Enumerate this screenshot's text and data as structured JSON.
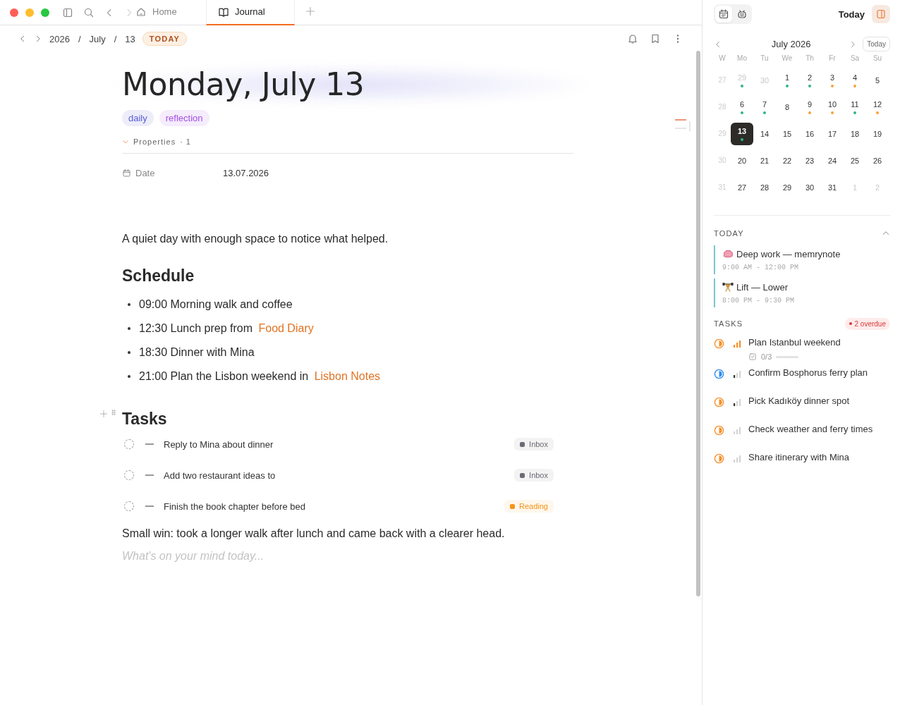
{
  "window": {
    "tabs": [
      {
        "label": "Home",
        "selected": false
      },
      {
        "label": "Journal",
        "selected": true
      }
    ]
  },
  "breadcrumb": {
    "parts": [
      "2026",
      "July",
      "13"
    ],
    "separator": "/",
    "badge": "TODAY"
  },
  "page": {
    "title": "Monday, July 13",
    "tags": [
      {
        "label": "daily",
        "color": "#5b5bd6"
      },
      {
        "label": "reflection",
        "color": "#a24ee8"
      }
    ],
    "properties": {
      "label": "Properties",
      "count": "· 1",
      "expanded": true,
      "rows": [
        {
          "name": "Date",
          "value": "13.07.2026"
        }
      ]
    },
    "intro": "A quiet day with enough space to notice what helped.",
    "schedule": {
      "heading": "Schedule",
      "items": [
        {
          "text": "09:00 Morning walk and coffee"
        },
        {
          "text": "12:30 Lunch prep from",
          "link": "Food Diary"
        },
        {
          "text": "18:30 Dinner with Mina"
        },
        {
          "text": "21:00 Plan the Lisbon weekend in",
          "link": "Lisbon Notes"
        }
      ]
    },
    "tasks": {
      "heading": "Tasks",
      "items": [
        {
          "text": "Reply to Mina about dinner",
          "checked": false,
          "tag": {
            "label": "Inbox",
            "color": "#6b6b75"
          }
        },
        {
          "text": "Add two restaurant ideas to",
          "checked": false,
          "tag": {
            "label": "Inbox",
            "color": "#6b6b75"
          }
        },
        {
          "text": "Finish the book chapter before bed",
          "checked": false,
          "tag": {
            "label": "Reading",
            "color": "#f59416"
          }
        }
      ]
    },
    "closing": "Small win: took a longer walk after lunch and came back with a clearer head.",
    "placeholder": "What's on your mind today..."
  },
  "sidebar": {
    "modes": [
      {
        "selected": true
      },
      {
        "selected": false
      }
    ],
    "today_label": "Today",
    "calendar": {
      "month": "July 2026",
      "today_button": "Today",
      "headers": [
        "W",
        "Mo",
        "Tu",
        "We",
        "Th",
        "Fr",
        "Sa",
        "Su"
      ],
      "weeks": [
        {
          "week": "27",
          "days": [
            {
              "d": "29",
              "muted": true,
              "selected": false,
              "color": "#2fb67c"
            },
            {
              "d": "30",
              "muted": true,
              "selected": false
            },
            {
              "d": "1",
              "muted": false,
              "selected": false,
              "color": "#2fb67c"
            },
            {
              "d": "2",
              "muted": false,
              "selected": false,
              "color": "#2fb67c"
            },
            {
              "d": "3",
              "muted": false,
              "selected": false,
              "color": "#f7a23a"
            },
            {
              "d": "4",
              "muted": false,
              "selected": false,
              "color": "#f7a23a"
            },
            {
              "d": "5",
              "muted": false,
              "selected": false
            }
          ]
        },
        {
          "week": "28",
          "days": [
            {
              "d": "6",
              "muted": false,
              "selected": false,
              "color": "#2fb67c"
            },
            {
              "d": "7",
              "muted": false,
              "selected": false,
              "color": "#2fb67c"
            },
            {
              "d": "8",
              "muted": false,
              "selected": false
            },
            {
              "d": "9",
              "muted": false,
              "selected": false,
              "color": "#f7a23a"
            },
            {
              "d": "10",
              "muted": false,
              "selected": false,
              "color": "#f7a23a"
            },
            {
              "d": "11",
              "muted": false,
              "selected": false,
              "color": "#2fb67c"
            },
            {
              "d": "12",
              "muted": false,
              "selected": false,
              "color": "#f7a23a"
            }
          ]
        },
        {
          "week": "29",
          "days": [
            {
              "d": "13",
              "muted": false,
              "selected": true,
              "color": "#2fb67c"
            },
            {
              "d": "14",
              "muted": false,
              "selected": false
            },
            {
              "d": "15",
              "muted": false,
              "selected": false
            },
            {
              "d": "16",
              "muted": false,
              "selected": false
            },
            {
              "d": "17",
              "muted": false,
              "selected": false
            },
            {
              "d": "18",
              "muted": false,
              "selected": false
            },
            {
              "d": "19",
              "muted": false,
              "selected": false
            }
          ]
        },
        {
          "week": "30",
          "days": [
            {
              "d": "20",
              "muted": false,
              "selected": false
            },
            {
              "d": "21",
              "muted": false,
              "selected": false
            },
            {
              "d": "22",
              "muted": false,
              "selected": false
            },
            {
              "d": "23",
              "muted": false,
              "selected": false
            },
            {
              "d": "24",
              "muted": false,
              "selected": false
            },
            {
              "d": "25",
              "muted": false,
              "selected": false
            },
            {
              "d": "26",
              "muted": false,
              "selected": false
            }
          ]
        },
        {
          "week": "31",
          "days": [
            {
              "d": "27",
              "muted": false,
              "selected": false
            },
            {
              "d": "28",
              "muted": false,
              "selected": false
            },
            {
              "d": "29",
              "muted": false,
              "selected": false
            },
            {
              "d": "30",
              "muted": false,
              "selected": false
            },
            {
              "d": "31",
              "muted": false,
              "selected": false
            },
            {
              "d": "1",
              "muted": true,
              "selected": false
            },
            {
              "d": "2",
              "muted": true,
              "selected": false
            }
          ]
        }
      ]
    },
    "today": {
      "heading": "TODAY",
      "expanded": true,
      "events": [
        {
          "title": "Deep work — memrynote",
          "time": "9:00 AM - 12:00 PM"
        },
        {
          "title": "Lift — Lower",
          "time": "8:00 PM - 9:30 PM"
        }
      ]
    },
    "tasks": {
      "heading": "TASKS",
      "overdue": "2 overdue",
      "items": [
        {
          "title": "Plan Istanbul weekend",
          "color": "#f7902a",
          "kind": "high",
          "subtasks": "0/3",
          "level": 0
        },
        {
          "title": "Confirm Bosphorus ferry plan",
          "color": "#2d8cf0",
          "kind": "medium"
        },
        {
          "title": "Pick Kadıköy dinner spot",
          "color": "#f7902a",
          "kind": "medium"
        },
        {
          "title": "Check weather and ferry times",
          "color": "#f7902a",
          "kind": "low"
        },
        {
          "title": "Share itinerary with Mina",
          "color": "#f7902a",
          "kind": "low"
        }
      ]
    }
  }
}
